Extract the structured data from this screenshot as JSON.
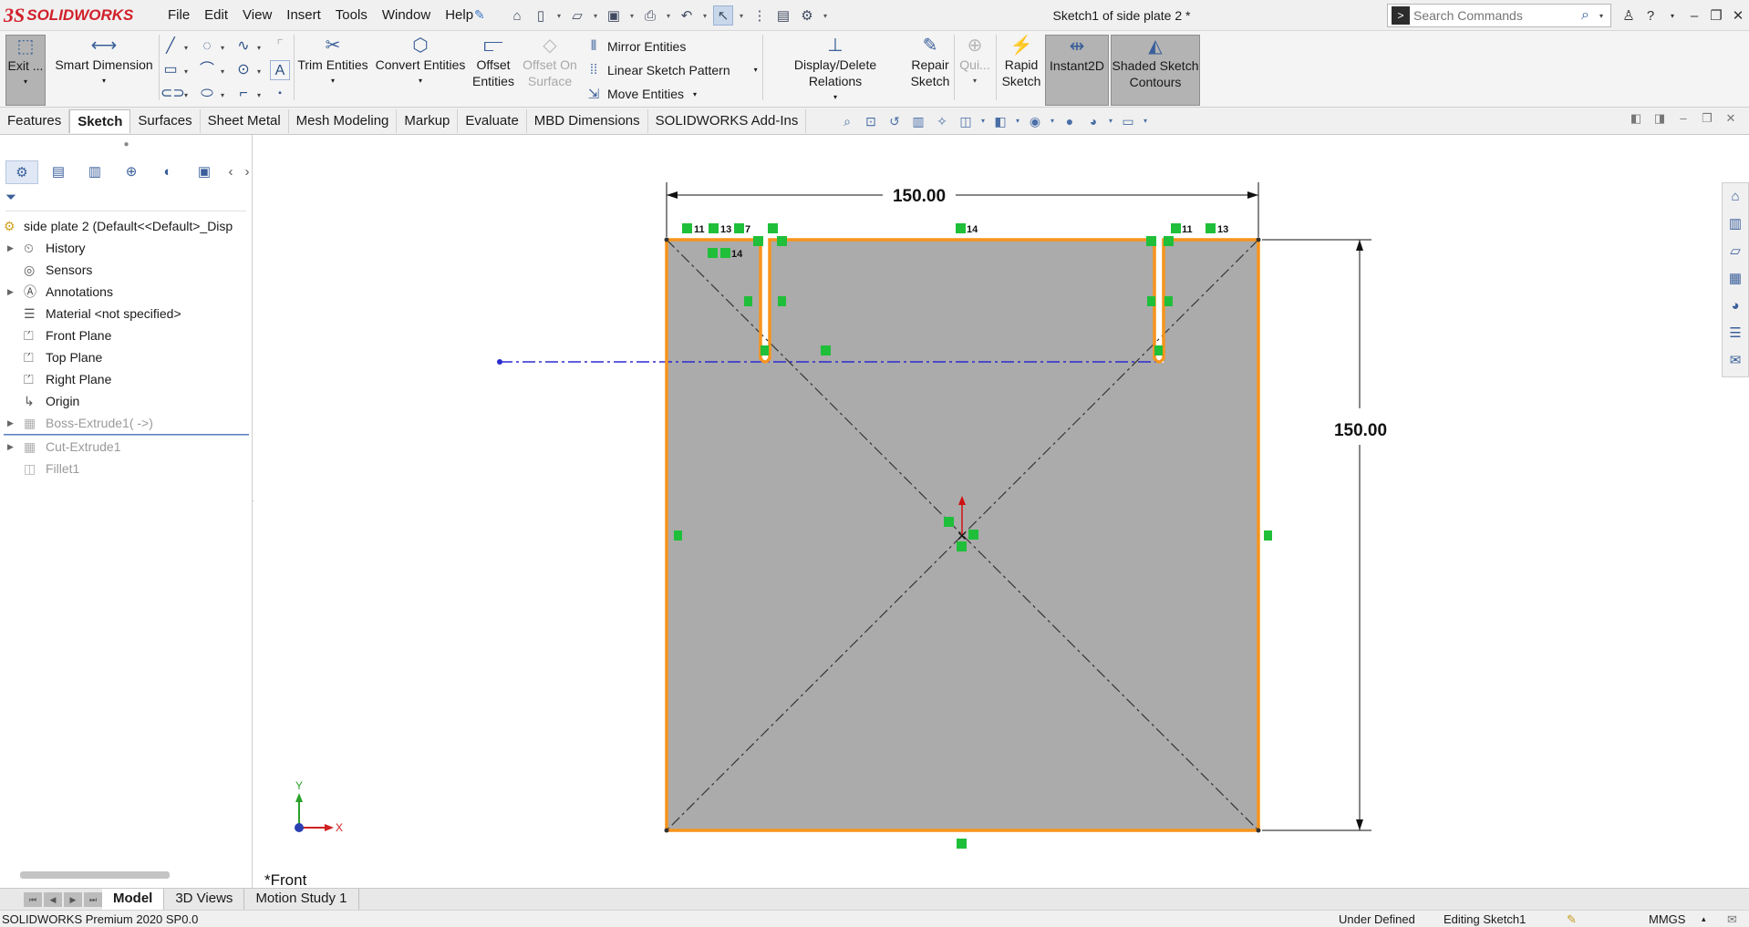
{
  "app": {
    "logo_prefix": "3S",
    "logo_name": "SOLIDWORKS",
    "doc_title": "Sketch1 of side plate 2 *"
  },
  "menus": [
    "File",
    "Edit",
    "View",
    "Insert",
    "Tools",
    "Window",
    "Help"
  ],
  "search": {
    "placeholder": "Search Commands"
  },
  "ribbon": {
    "exit": "Exit ...",
    "smart_dimension": "Smart Dimension",
    "trim": "Trim Entities",
    "convert": "Convert Entities",
    "offset_1": "Offset",
    "offset_2": "Entities",
    "offset_surface_1": "Offset On",
    "offset_surface_2": "Surface",
    "mirror": "Mirror Entities",
    "linear_pattern": "Linear Sketch Pattern",
    "move": "Move Entities",
    "relations": "Display/Delete Relations",
    "repair_1": "Repair",
    "repair_2": "Sketch",
    "quick": "Qui...",
    "rapid_1": "Rapid",
    "rapid_2": "Sketch",
    "instant2d": "Instant2D",
    "shaded_1": "Shaded Sketch",
    "shaded_2": "Contours"
  },
  "tabs": [
    "Features",
    "Sketch",
    "Surfaces",
    "Sheet Metal",
    "Mesh Modeling",
    "Markup",
    "Evaluate",
    "MBD Dimensions",
    "SOLIDWORKS Add-Ins"
  ],
  "active_tab": "Sketch",
  "tree": {
    "root": "side plate 2  (Default<<Default>_Disp",
    "items": [
      {
        "label": "History",
        "expandable": true
      },
      {
        "label": "Sensors",
        "expandable": false
      },
      {
        "label": "Annotations",
        "expandable": true
      },
      {
        "label": "Material <not specified>",
        "expandable": false
      },
      {
        "label": "Front Plane",
        "expandable": false
      },
      {
        "label": "Top Plane",
        "expandable": false
      },
      {
        "label": "Right Plane",
        "expandable": false
      },
      {
        "label": "Origin",
        "expandable": false
      }
    ],
    "suppressed": [
      {
        "label": "Boss-Extrude1( ->)",
        "expandable": true
      },
      {
        "label": "Cut-Extrude1",
        "expandable": true
      },
      {
        "label": "Fillet1",
        "expandable": false
      }
    ]
  },
  "sketch": {
    "dim_width": "150.00",
    "dim_height": "150.00",
    "relation_labels": [
      "11",
      "13",
      "7",
      "14",
      "14",
      "11",
      "13"
    ],
    "view_label": "*Front",
    "triad_x": "X",
    "triad_y": "Y",
    "colors": {
      "profile": "#f7941d",
      "fill": "#ababab",
      "centerline": "#2b2bd0",
      "relation": "#1fbf3a"
    }
  },
  "model_tabs": [
    "Model",
    "3D Views",
    "Motion Study 1"
  ],
  "active_model_tab": "Model",
  "status": {
    "product": "SOLIDWORKS Premium 2020 SP0.0",
    "state": "Under Defined",
    "editing": "Editing Sketch1",
    "units": "MMGS"
  }
}
